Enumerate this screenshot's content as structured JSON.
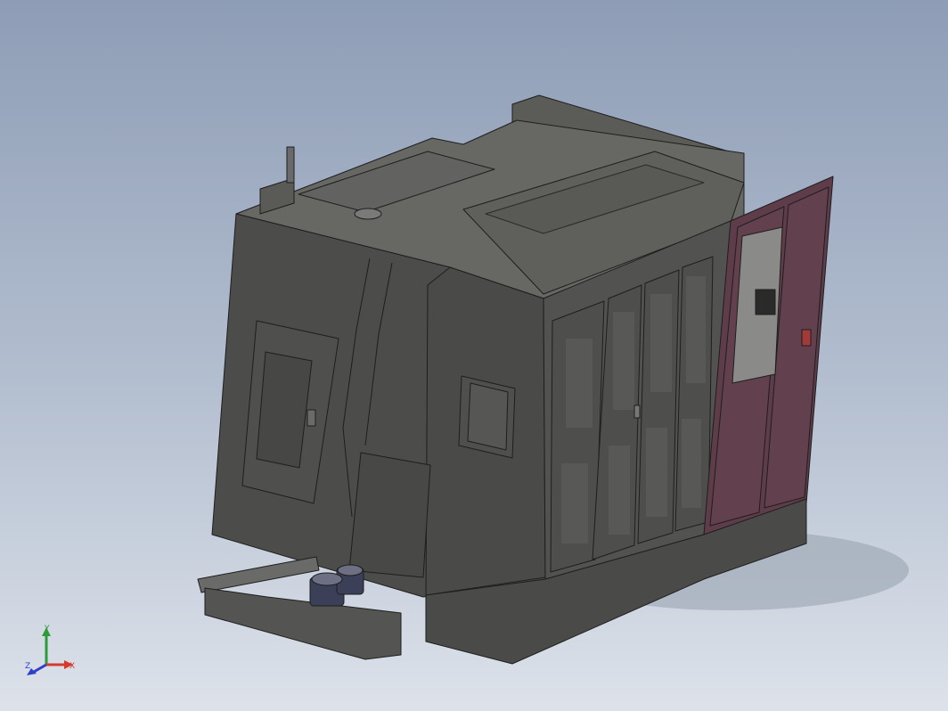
{
  "viewport": {
    "background_top": "#8e9db6",
    "background_bottom": "#dde2ea"
  },
  "model": {
    "body_color": "#4c4c4a",
    "door_panel_color": "#5e3c4a"
  },
  "triad": {
    "x_label": "X",
    "y_label": "Y",
    "z_label": "Z",
    "x_color": "#d63a2f",
    "y_color": "#2f9a3a",
    "z_color": "#2f3fc8"
  }
}
